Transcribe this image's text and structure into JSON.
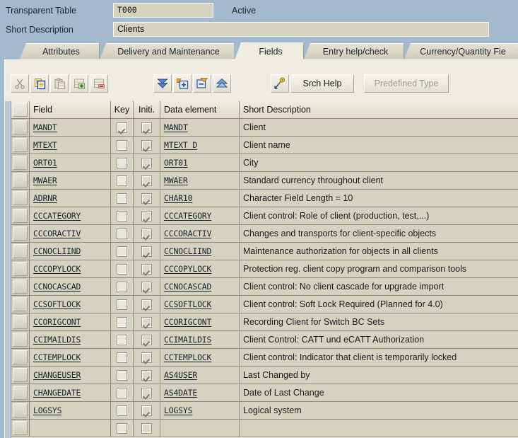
{
  "header": {
    "table_type_label": "Transparent Table",
    "table_name": "T000",
    "status": "Active",
    "short_desc_label": "Short Description",
    "short_desc_value": "Clients"
  },
  "tabs": [
    {
      "label": "Attributes",
      "active": false
    },
    {
      "label": "Delivery and Maintenance",
      "active": false
    },
    {
      "label": "Fields",
      "active": true
    },
    {
      "label": "Entry help/check",
      "active": false
    },
    {
      "label": "Currency/Quantity Fie",
      "active": false
    }
  ],
  "toolbar": {
    "icons": [
      {
        "name": "cut-icon",
        "enabled": false
      },
      {
        "name": "copy-icon",
        "enabled": true
      },
      {
        "name": "paste-icon",
        "enabled": false
      },
      {
        "name": "insert-row-icon",
        "enabled": false
      },
      {
        "name": "delete-row-icon",
        "enabled": false
      },
      {
        "name": "expand-all-icon",
        "enabled": true
      },
      {
        "name": "insert-field-icon",
        "enabled": true
      },
      {
        "name": "delete-field-icon",
        "enabled": true
      },
      {
        "name": "collapse-all-icon",
        "enabled": true
      },
      {
        "name": "key-navigate-icon",
        "enabled": true
      }
    ],
    "search_help_label": "Srch Help",
    "predefined_type_label": "Predefined Type",
    "predefined_type_enabled": false
  },
  "grid": {
    "columns": [
      {
        "key": "field",
        "label": "Field"
      },
      {
        "key": "key",
        "label": "Key"
      },
      {
        "key": "init",
        "label": "Initi."
      },
      {
        "key": "data_element",
        "label": "Data element"
      },
      {
        "key": "short_description",
        "label": "Short Description"
      }
    ],
    "rows": [
      {
        "field": "MANDT",
        "key": true,
        "init": true,
        "data_element": "MANDT",
        "short_description": "Client"
      },
      {
        "field": "MTEXT",
        "key": false,
        "init": true,
        "data_element": "MTEXT_D",
        "short_description": "Client name"
      },
      {
        "field": "ORT01",
        "key": false,
        "init": true,
        "data_element": "ORT01",
        "short_description": "City"
      },
      {
        "field": "MWAER",
        "key": false,
        "init": true,
        "data_element": "MWAER",
        "short_description": "Standard currency throughout client"
      },
      {
        "field": "ADRNR",
        "key": false,
        "init": true,
        "data_element": "CHAR10",
        "short_description": "Character Field Length = 10"
      },
      {
        "field": "CCCATEGORY",
        "key": false,
        "init": true,
        "data_element": "CCCATEGORY",
        "short_description": "Client control: Role of client (production, test,...)"
      },
      {
        "field": "CCCORACTIV",
        "key": false,
        "init": true,
        "data_element": "CCCORACTIV",
        "short_description": "Changes and transports for client-specific objects"
      },
      {
        "field": "CCNOCLIIND",
        "key": false,
        "init": true,
        "data_element": "CCNOCLIIND",
        "short_description": "Maintenance authorization for objects in all clients"
      },
      {
        "field": "CCCOPYLOCK",
        "key": false,
        "init": true,
        "data_element": "CCCOPYLOCK",
        "short_description": "Protection reg. client copy program and comparison tools"
      },
      {
        "field": "CCNOCASCAD",
        "key": false,
        "init": true,
        "data_element": "CCNOCASCAD",
        "short_description": "Client control: No client cascade for upgrade import"
      },
      {
        "field": "CCSOFTLOCK",
        "key": false,
        "init": true,
        "data_element": "CCSOFTLOCK",
        "short_description": "Client control: Soft Lock Required (Planned for 4.0)"
      },
      {
        "field": "CCORIGCONT",
        "key": false,
        "init": true,
        "data_element": "CCORIGCONT",
        "short_description": "Recording Client for Switch BC Sets"
      },
      {
        "field": "CCIMAILDIS",
        "key": false,
        "init": true,
        "data_element": "CCIMAILDIS",
        "short_description": "Client Control: CATT und eCATT Authorization"
      },
      {
        "field": "CCTEMPLOCK",
        "key": false,
        "init": true,
        "data_element": "CCTEMPLOCK",
        "short_description": "Client control: Indicator that client is temporarily locked"
      },
      {
        "field": "CHANGEUSER",
        "key": false,
        "init": true,
        "data_element": "AS4USER",
        "short_description": "Last Changed by"
      },
      {
        "field": "CHANGEDATE",
        "key": false,
        "init": true,
        "data_element": "AS4DATE",
        "short_description": "Date of Last Change"
      },
      {
        "field": "LOGSYS",
        "key": false,
        "init": true,
        "data_element": "LOGSYS",
        "short_description": "Logical system"
      }
    ]
  },
  "colors": {
    "window_background": "#a3b9cd",
    "panel_background": "#efece2",
    "cell_background": "#d6d2c0",
    "grid_line": "#8d8a7c",
    "text": "#16242e"
  }
}
